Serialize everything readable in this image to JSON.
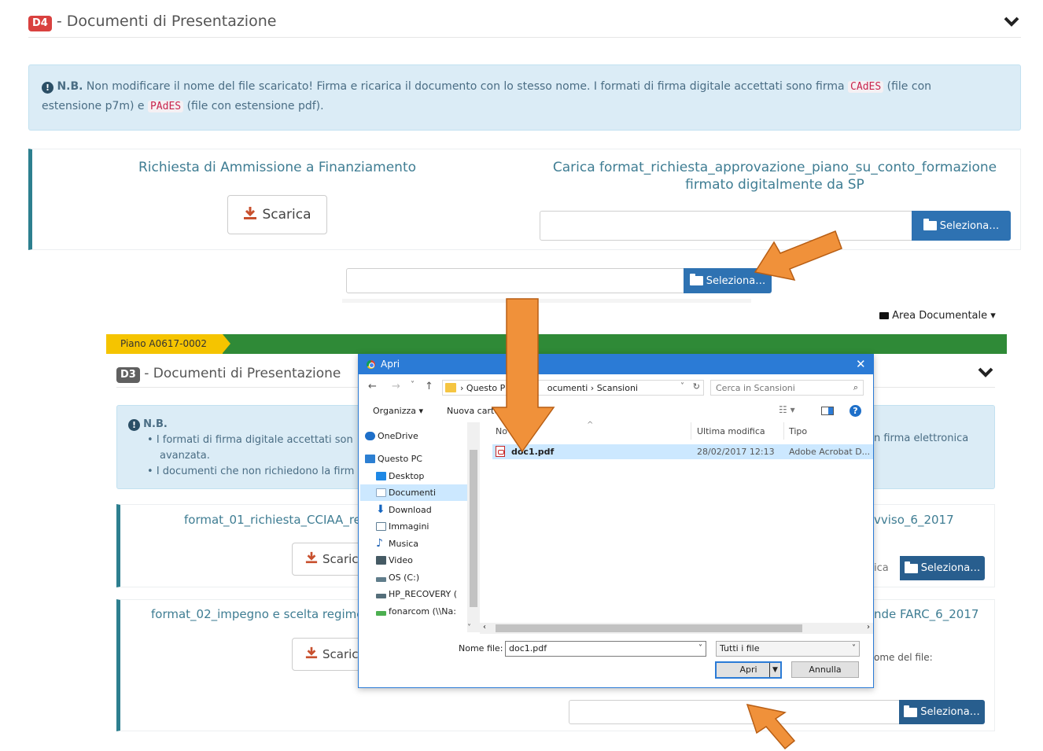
{
  "top_section": {
    "badge": "D4",
    "title": " - Documenti di Presentazione",
    "alert": {
      "icon": "info-circle-icon",
      "nb": "N.B.",
      "text1": " Non modificare il nome del file scaricato! Firma e ricarica il documento con lo stesso nome. I formati di firma digitale accettati sono firma ",
      "code1": "CAdES",
      "text2": " (file con",
      "text3": "estensione p7m) e ",
      "code2": "PAdES",
      "text4": " (file con estensione pdf)."
    },
    "doc_label": "Richiesta di Ammissione a Finanziamento",
    "download_label": "Scarica",
    "upload_label_line1": "Carica format_richiesta_approvazione_piano_su_conto_formazione",
    "upload_label_line2": "firmato digitalmente da SP",
    "select_label": "Seleziona…"
  },
  "middle_upload": {
    "select_label": "Seleziona…"
  },
  "bottom_section": {
    "area_documentale": "Area Documentale",
    "piano_tag": "Piano A0617-0002",
    "badge": "D3",
    "title": " - Documenti di Presentazione",
    "alert": {
      "nb": "N.B.",
      "bullet1_a": "I formati di firma digitale accettati son",
      "bullet1_b": "n firma elettronica",
      "bullet1_c": "avanzata.",
      "bullet2": "I documenti che non richiedono la firm"
    },
    "row1": {
      "label_left": "format_01_richiesta_CCIAA_re",
      "label_right": "vviso_6_2017",
      "download_label": "Scaric",
      "partial_btn": "ica",
      "select_label": "Seleziona…"
    },
    "row2": {
      "label_left": "format_02_impegno e scelta regime",
      "label_right": "nde FARC_6_2017",
      "download_label": "Scaric",
      "side_text": "ome del file:",
      "select_label": "Seleziona…"
    }
  },
  "dialog": {
    "title": "Apri",
    "breadcrumb": [
      "Questo P",
      "ocumenti",
      "Scansioni"
    ],
    "search_placeholder": "Cerca in Scansioni",
    "organizza": "Organizza ▾",
    "nuova_cartella": "Nuova cartella",
    "tree": [
      {
        "label": "OneDrive",
        "icon": "onedrive-icon",
        "color": "#1e6fc9"
      },
      {
        "label": "Questo PC",
        "icon": "computer-icon",
        "color": "#2c7fd2"
      },
      {
        "label": "Desktop",
        "icon": "desktop-icon",
        "color": "#1e88e5"
      },
      {
        "label": "Documenti",
        "icon": "documents-icon",
        "color": "#8aa7c4"
      },
      {
        "label": "Download",
        "icon": "download-icon",
        "color": "#1565c0"
      },
      {
        "label": "Immagini",
        "icon": "pictures-icon",
        "color": "#5f7f96"
      },
      {
        "label": "Musica",
        "icon": "music-icon",
        "color": "#1f62b5"
      },
      {
        "label": "Video",
        "icon": "video-icon",
        "color": "#455a64"
      },
      {
        "label": "OS (C:)",
        "icon": "drive-icon",
        "color": "#607d8b"
      },
      {
        "label": "HP_RECOVERY (",
        "icon": "drive-icon",
        "color": "#546e7a"
      },
      {
        "label": "fonarcom (\\\\Na:",
        "icon": "network-drive-icon",
        "color": "#4caf50"
      }
    ],
    "columns": {
      "name": "No",
      "modified": "Ultima modifica",
      "type": "Tipo"
    },
    "file": {
      "name": "doc1.pdf",
      "modified": "28/02/2017 12:13",
      "type": "Adobe Acrobat D..."
    },
    "filename_label": "Nome file:",
    "filename_value": "doc1.pdf",
    "filter_value": "Tutti i file",
    "open_btn": "Apri",
    "cancel_btn": "Annulla"
  },
  "colors": {
    "accent_blue": "#2e72b2",
    "arrow_orange": "#f0913a",
    "green_bar": "#2f8a37",
    "yellow_tag": "#f5c400",
    "badge_red": "#d9413f"
  }
}
